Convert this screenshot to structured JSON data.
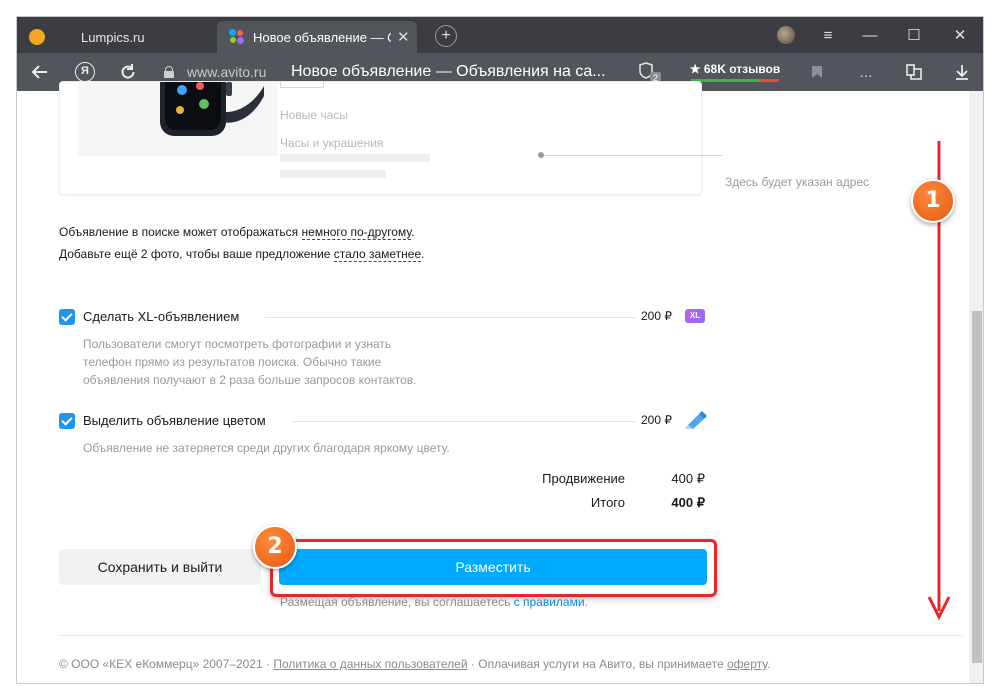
{
  "browser": {
    "tabs": [
      {
        "title": "Lumpics.ru",
        "active": false
      },
      {
        "title": "Новое объявление — О",
        "active": true
      }
    ],
    "new_tab": "+",
    "window_controls": {
      "menu": "≡",
      "minimize": "—",
      "maximize": "☐",
      "close": "✕"
    },
    "address": {
      "domain": "www.avito.ru",
      "title": "Новое объявление — Объявления на са...",
      "reviews": "★ 68K отзывов",
      "ya_label": "Я",
      "tab_count": "2"
    }
  },
  "preview": {
    "line1": "Новые часы",
    "line2": "Часы и украшения",
    "address_hint": "Здесь будет указан адрес"
  },
  "notes": {
    "line1_prefix": "Объявление в поиске может отображаться ",
    "line1_link": "немного по-другому",
    "line1_suffix": ".",
    "line2_prefix": "Добавьте ещё 2 фото, чтобы ваше предложение ",
    "line2_link": "стало заметнее",
    "line2_suffix": "."
  },
  "options": [
    {
      "label": "Сделать XL-объявлением",
      "price": "200 ₽",
      "badge": "XL",
      "checked": true,
      "description": [
        "Пользователи смогут посмотреть фотографии и узнать",
        "телефон прямо из результатов поиска. Обычно такие",
        "объявления получают в 2 раза больше запросов контактов."
      ]
    },
    {
      "label": "Выделить объявление цветом",
      "price": "200 ₽",
      "checked": true,
      "description": [
        "Объявление не затеряется среди других благодаря яркому цвету."
      ]
    }
  ],
  "summary": {
    "promotion_label": "Продвижение",
    "promotion_value": "400 ₽",
    "total_label": "Итого",
    "total_value": "400 ₽"
  },
  "actions": {
    "save_label": "Сохранить и выйти",
    "publish_label": "Разместить",
    "agree_prefix": "Размещая объявление, вы соглашаетесь ",
    "agree_link": "с правилами",
    "agree_suffix": "."
  },
  "footer": {
    "copyright": "© ООО «КЕХ еКоммерц» 2007–2021",
    "sep": " · ",
    "privacy": "Политика о данных пользователей",
    "services_prefix": "Оплачивая услуги на Авито, вы принимаете ",
    "offer": "оферту",
    "services_suffix": "."
  },
  "annotations": [
    {
      "number": "1"
    },
    {
      "number": "2"
    }
  ],
  "colors": {
    "accent": "#00aaff",
    "checkbox": "#1e96f0",
    "annotation_red": "#e8272d",
    "annotation_orange": "#f26a1f"
  }
}
